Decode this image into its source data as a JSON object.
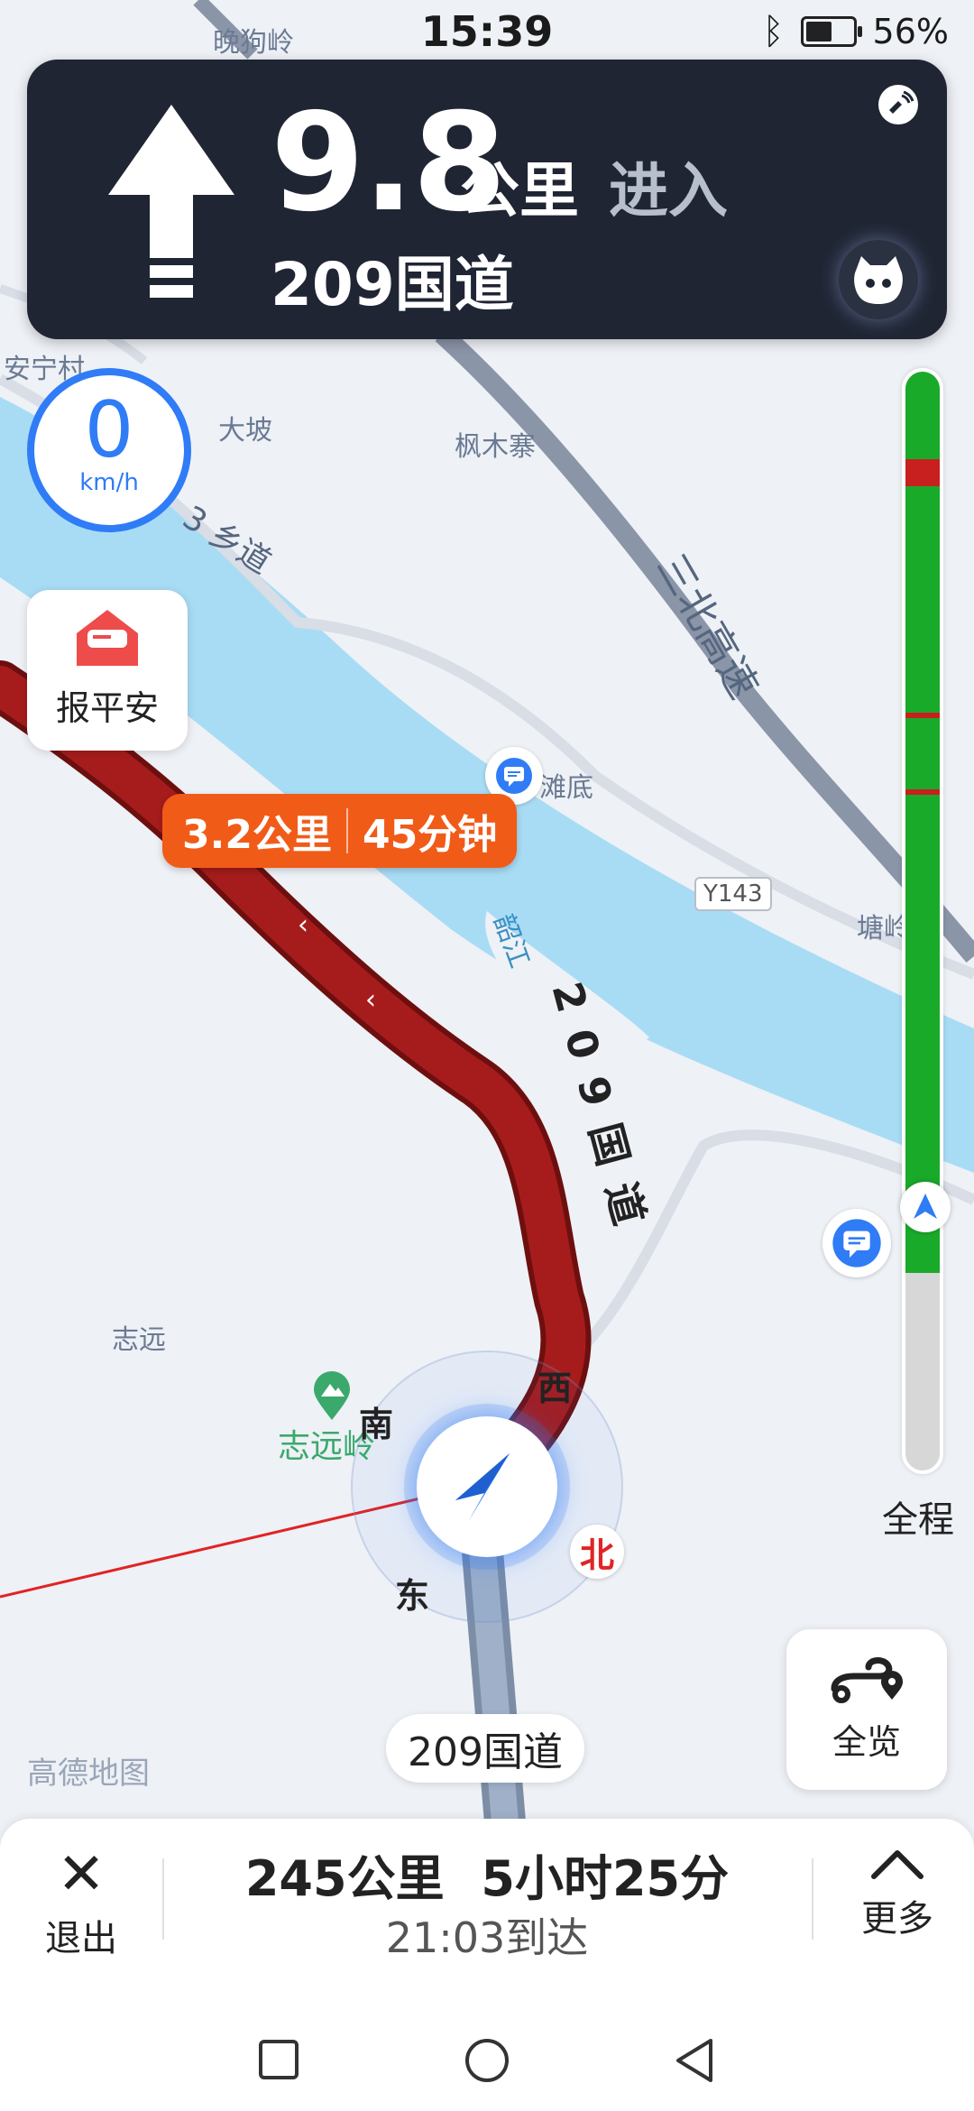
{
  "status_bar": {
    "time": "15:39",
    "battery_text": "56%",
    "battery_level": 0.56,
    "icons": [
      "bluetooth-icon",
      "battery-icon"
    ]
  },
  "navigation": {
    "distance_value": "9.8",
    "distance_unit": "公里",
    "action": "进入",
    "road_name": "209国道",
    "maneuver_icon": "straight-arrow-icon"
  },
  "speed": {
    "value": "0",
    "unit": "km/h"
  },
  "safe_report": {
    "label": "报平安"
  },
  "route_tag": {
    "distance": "3.2公里",
    "time": "45分钟"
  },
  "map_labels": {
    "top_village": "晚狗岭",
    "village1": "安宁村",
    "dapo": "大坡",
    "fengmuzhai": "枫木寨",
    "township_road": "3 乡道",
    "expressway": "三北高速",
    "tandi": "滩底",
    "tangshan": "塘岭",
    "y143": "Y143",
    "river": "韶江",
    "route_road": "209国道",
    "zhiyuan": "志远",
    "zhiyuan_ling": "志远岭"
  },
  "compass": {
    "south": "南",
    "west": "西",
    "east": "东",
    "north": "北"
  },
  "progress": {
    "label": "全程",
    "completed_fraction": 0.82,
    "congestion_segments": [
      0.08,
      0.31,
      0.38
    ]
  },
  "current_road_chip": "209国道",
  "overview_button": {
    "label": "全览"
  },
  "brand": "高德地图",
  "trip": {
    "distance": "245公里",
    "duration": "5小时25分",
    "arrival": "21:03到达"
  },
  "bottom": {
    "exit_label": "退出",
    "more_label": "更多"
  },
  "colors": {
    "nav_card": "#1f2533",
    "accent_blue": "#2f7cf6",
    "tag_orange": "#f15b18",
    "route_red": "#9e1a1a",
    "river": "#a8dcf5",
    "progress_green": "#1aaa2a"
  }
}
